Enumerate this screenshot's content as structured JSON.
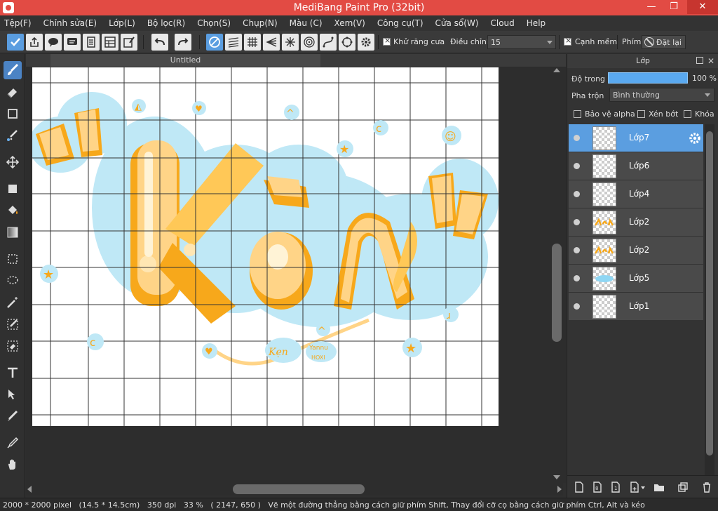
{
  "window": {
    "title": "MediBang Paint Pro (32bit)",
    "minimize": "—",
    "maximize": "❐",
    "close": "✕"
  },
  "menu": [
    "Tệp(F)",
    "Chỉnh sửa(E)",
    "Lớp(L)",
    "Bộ lọc(R)",
    "Chọn(S)",
    "Chụp(N)",
    "Màu (C)",
    "Xem(V)",
    "Công cụ(T)",
    "Cửa sổ(W)",
    "Cloud",
    "Help"
  ],
  "toolbar": {
    "antialias_label": "Khử răng cưa",
    "adjust_label": "Điều chỉnh",
    "adjust_value": "15",
    "soft_edge_label": "Cạnh mềm",
    "key_label": "Phím",
    "reset_label": "Đặt lại"
  },
  "document": {
    "tab_title": "Untitled"
  },
  "layer_panel": {
    "title": "Lớp",
    "opacity_label": "Độ trong",
    "opacity_value": "100 %",
    "opacity_percent": 100,
    "blend_label": "Pha trộn",
    "blend_value": "Bình thường",
    "protect_alpha_label": "Bảo vệ alpha",
    "clipping_label": "Xén bớt",
    "lock_label": "Khóa",
    "layers": [
      {
        "name": "Lớp7",
        "selected": true,
        "thumb": "empty"
      },
      {
        "name": "Lớp6",
        "selected": false,
        "thumb": "empty"
      },
      {
        "name": "Lớp4",
        "selected": false,
        "thumb": "empty"
      },
      {
        "name": "Lớp2",
        "selected": false,
        "thumb": "orange"
      },
      {
        "name": "Lớp2",
        "selected": false,
        "thumb": "orange"
      },
      {
        "name": "Lớp5",
        "selected": false,
        "thumb": "blue"
      },
      {
        "name": "Lớp1",
        "selected": false,
        "thumb": "empty"
      }
    ]
  },
  "canvas": {
    "artwork_text": "Kẹn",
    "small_text": "Kẹn",
    "small_text_2": "Yannu",
    "small_text_3": "HOXI"
  },
  "status": {
    "canvas_size": "2000 * 2000 pixel",
    "physical_size": "(14.5 * 14.5cm)",
    "dpi": "350 dpi",
    "zoom": "33 %",
    "cursor": "( 2147, 650 )",
    "hint": "Vẽ một đường thẳng bằng cách giữ phím Shift, Thay đổi cỡ cọ bằng cách giữ phím Ctrl, Alt và kéo"
  },
  "colors": {
    "titlebar": "#e24b44",
    "accent": "#5b9ee0",
    "orange": "#f7a81b",
    "light_orange": "#ffd487",
    "sky": "#bfe8f6"
  }
}
